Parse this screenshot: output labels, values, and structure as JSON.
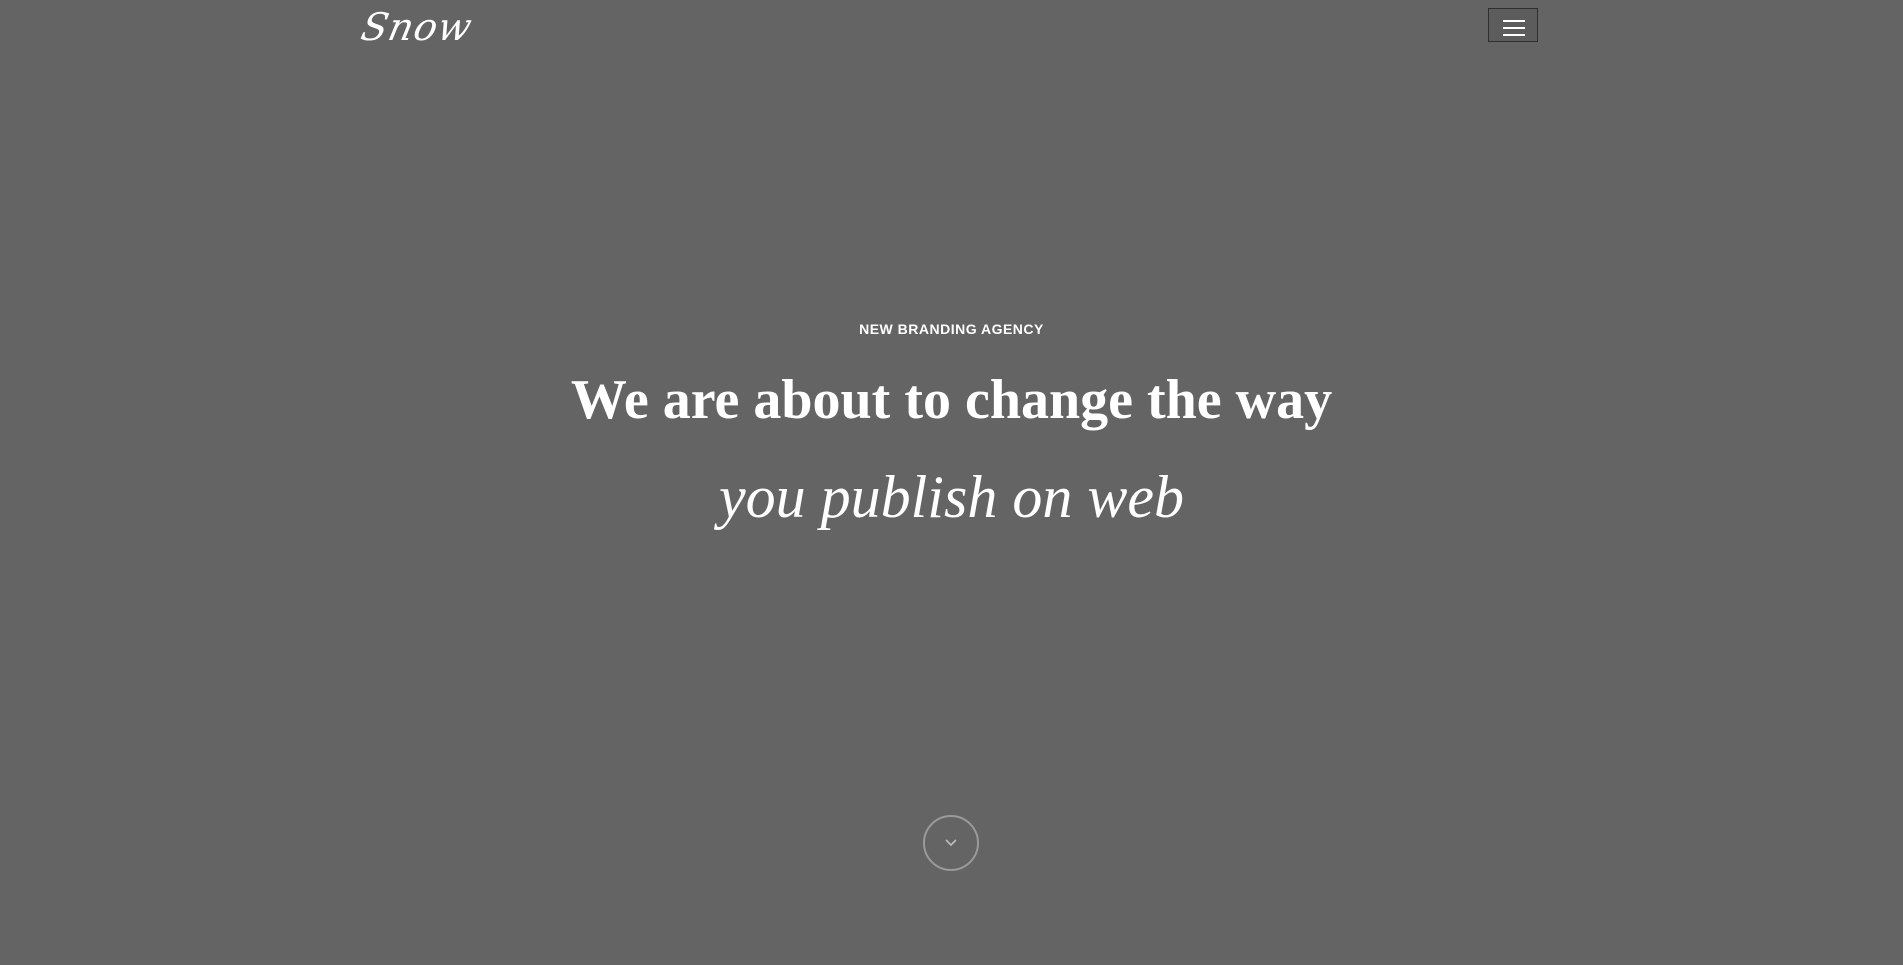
{
  "header": {
    "logo_text": "Snow",
    "menu_icon": "hamburger-menu-icon"
  },
  "hero": {
    "kicker": "NEW BRANDING AGENCY",
    "title_line1": "We are about to change the way",
    "title_line2": "you publish on web",
    "scroll_icon": "chevron-down-icon"
  },
  "colors": {
    "background": "#646464",
    "text": "#ffffff",
    "scroll_ring": "#9a9a9a"
  }
}
